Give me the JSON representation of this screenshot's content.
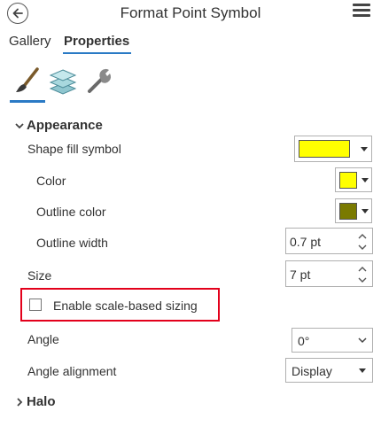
{
  "header": {
    "title": "Format Point Symbol",
    "back_icon": "back-arrow-icon",
    "menu_icon": "hamburger-menu-icon"
  },
  "tabs": [
    {
      "label": "Gallery"
    },
    {
      "label": "Properties"
    }
  ],
  "toolbar": {
    "icons": [
      "brush-icon",
      "layers-icon",
      "wrench-icon"
    ],
    "accent": "#2a7ac5"
  },
  "appearance": {
    "title": "Appearance",
    "shape_fill_symbol": {
      "label": "Shape fill symbol",
      "color": "#ffff00"
    },
    "color": {
      "label": "Color",
      "value": "#ffff00"
    },
    "outline_color": {
      "label": "Outline color",
      "value": "#7a7a00"
    },
    "outline_width": {
      "label": "Outline width",
      "value": "0.7 pt"
    }
  },
  "size": {
    "label": "Size",
    "value": "7 pt"
  },
  "scale_sizing": {
    "label": "Enable scale-based sizing",
    "checked": false
  },
  "angle": {
    "label": "Angle",
    "value": "0°"
  },
  "angle_alignment": {
    "label": "Angle alignment",
    "value": "Display"
  },
  "halo": {
    "title": "Halo"
  }
}
